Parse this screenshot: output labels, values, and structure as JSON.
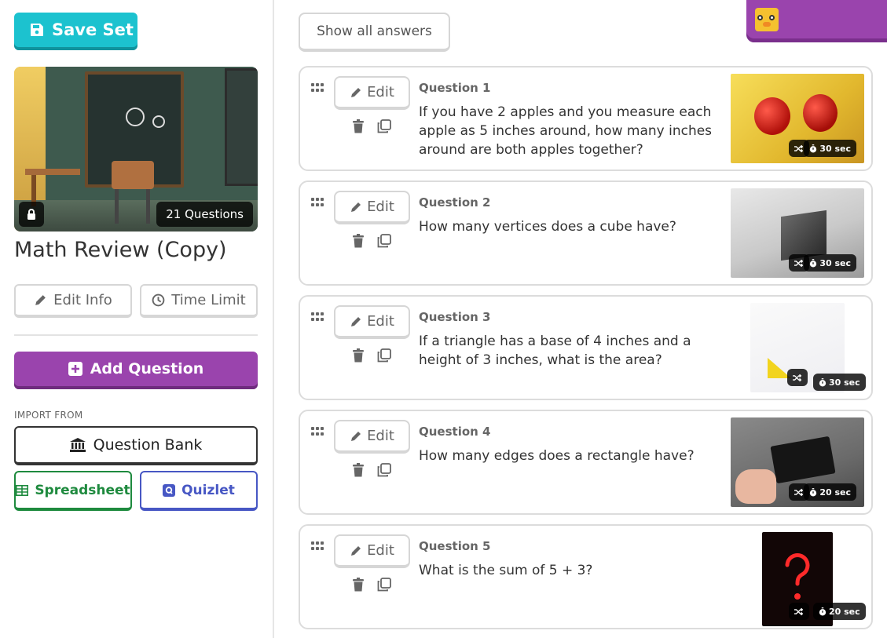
{
  "left_panel": {
    "save_label": "Save Set",
    "cover": {
      "question_count": "21 Questions"
    },
    "set_title": "Math Review (Copy)",
    "edit_info_label": "Edit Info",
    "time_limit_label": "Time Limit",
    "add_question_label": "Add Question",
    "import_from_label": "IMPORT FROM",
    "question_bank_label": "Question Bank",
    "spreadsheet_label": "Spreadsheet",
    "quizlet_label": "Quizlet"
  },
  "right_panel": {
    "show_answers_label": "Show all answers",
    "edit_label": "Edit",
    "questions": [
      {
        "number": "Question 1",
        "text": "If you have 2 apples and you measure each apple as 5 inches around, how many inches around are both apples together?",
        "time": "30 sec"
      },
      {
        "number": "Question 2",
        "text": "How many vertices does a cube have?",
        "time": "30 sec"
      },
      {
        "number": "Question 3",
        "text": "If a triangle has a base of 4 inches and a height of 3 inches, what is the area?",
        "time": "30 sec"
      },
      {
        "number": "Question 4",
        "text": "How many edges does a rectangle have?",
        "time": "20 sec"
      },
      {
        "number": "Question 5",
        "text": "What is the sum of 5 + 3?",
        "time": "20 sec"
      }
    ]
  },
  "colors": {
    "teal": "#1cc2cf",
    "purple": "#9a44ad",
    "green": "#1e8a3e",
    "blue": "#4757c4"
  },
  "icons": [
    "save-icon",
    "lock-icon",
    "pencil-icon",
    "clock-icon",
    "plus-square-icon",
    "bank-icon",
    "table-icon",
    "quizlet-icon",
    "grip-icon",
    "trash-icon",
    "duplicate-icon",
    "shuffle-icon",
    "stopwatch-icon"
  ]
}
